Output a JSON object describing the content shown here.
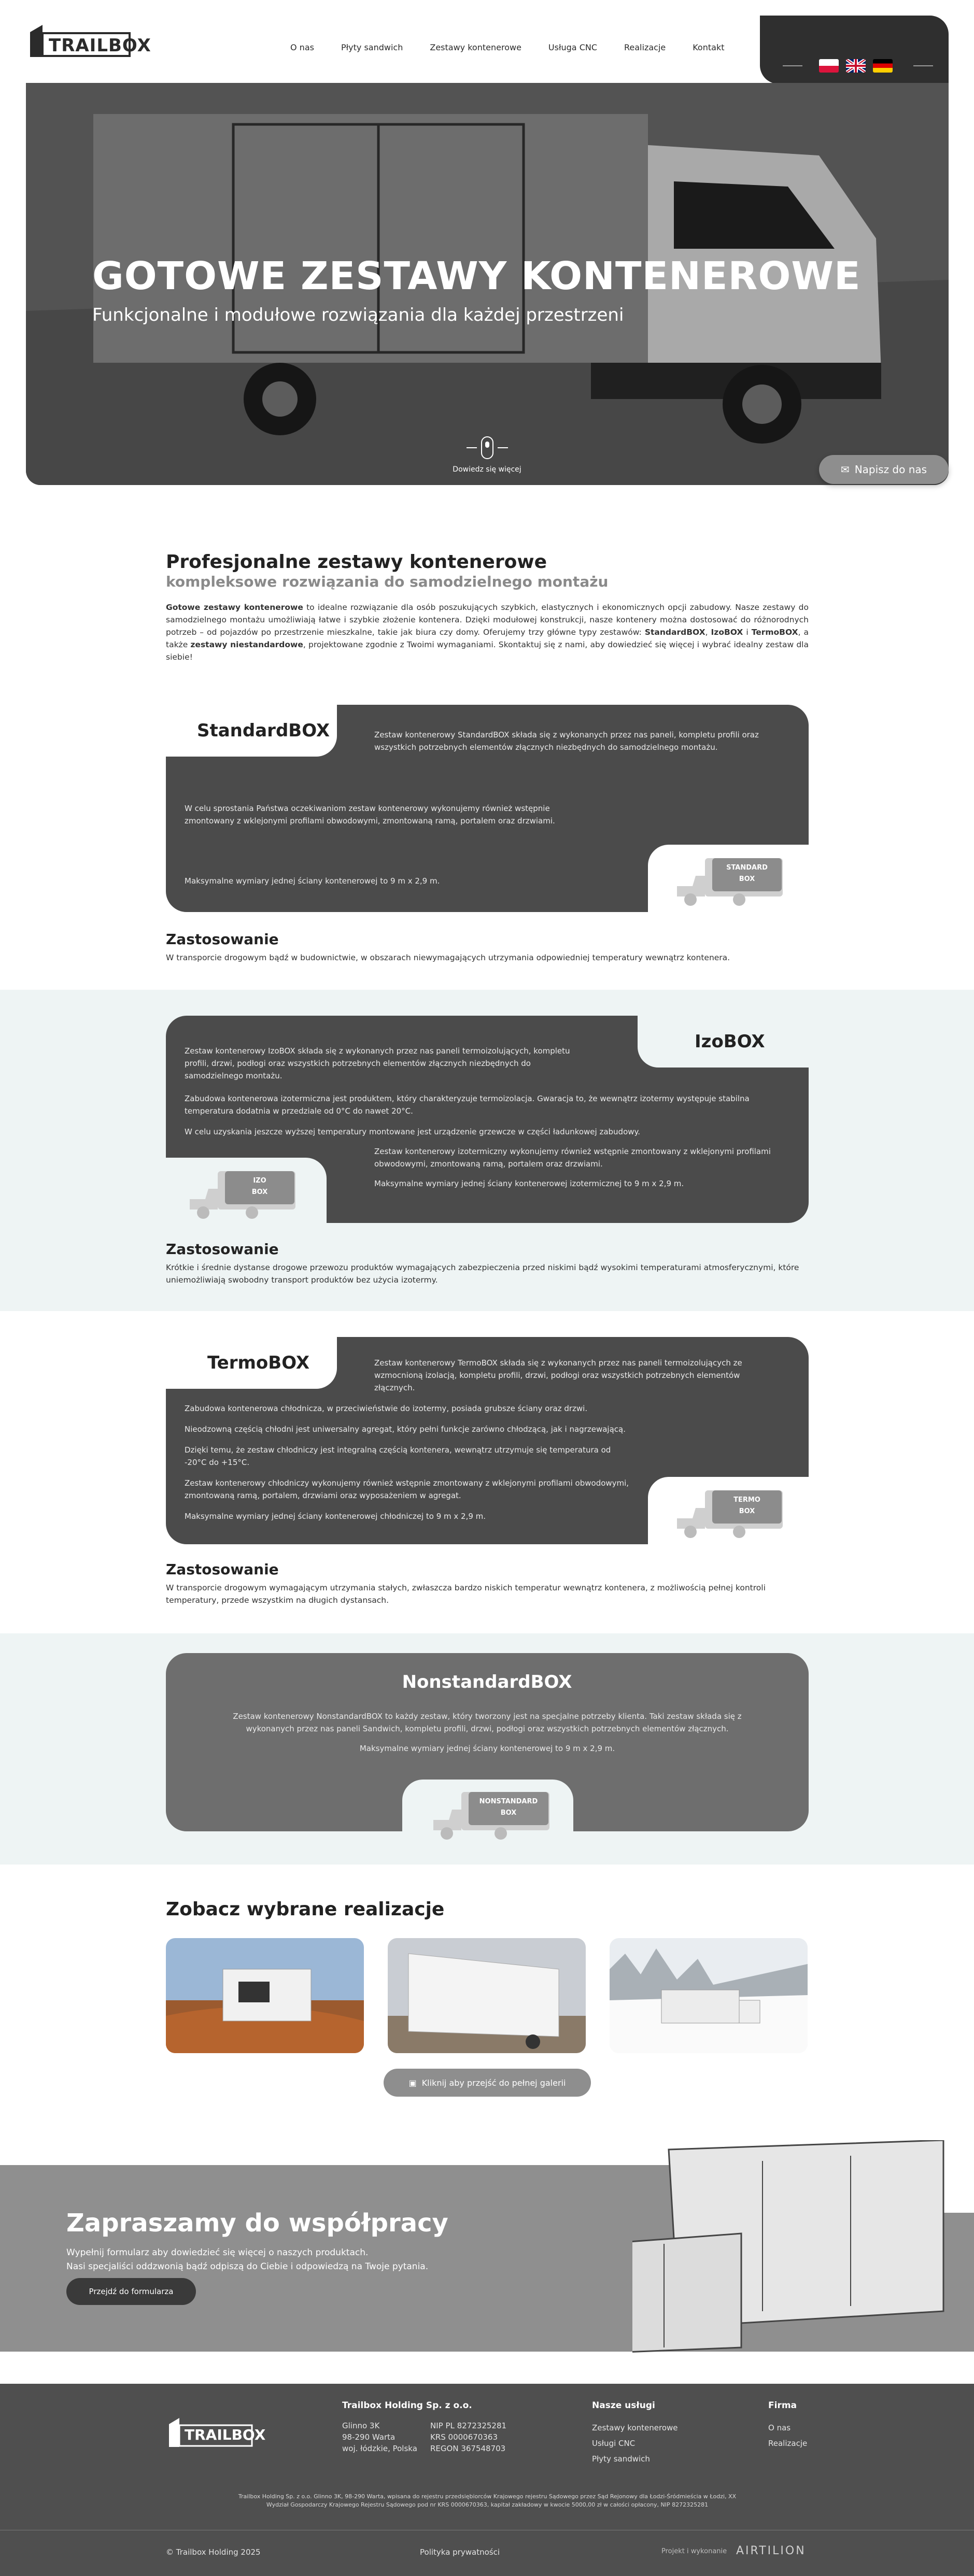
{
  "header": {
    "logo_text": "TRAILBOX",
    "nav": [
      "O nas",
      "Płyty sandwich",
      "Zestawy kontenerowe",
      "Usługa CNC",
      "Realizacje",
      "Kontakt"
    ]
  },
  "hero": {
    "title": "GOTOWE ZESTAWY KONTENEROWE",
    "subtitle": "Funkcjonalne i modułowe rozwiązania dla każdej przestrzeni",
    "scroll_label": "Dowiedz się więcej",
    "chat_button": "Napisz do nas"
  },
  "intro": {
    "title": "Profesjonalne zestawy kontenerowe",
    "subtitle": "kompleksowe rozwiązania do samodzielnego montażu",
    "p1_bold": "Gotowe zestawy kontenerowe",
    "p1_rest": " to idealne rozwiązanie dla osób poszukujących szybkich, elastycznych i ekonomicznych opcji zabudowy. Nasze zestawy do samodzielnego montażu umożliwiają łatwe i szybkie złożenie kontenera. Dzięki modułowej konstrukcji, nasze kontenery można dostosować do różnorodnych potrzeb – od pojazdów po przestrzenie mieszkalne, takie jak biura czy domy. Oferujemy trzy główne typy zestawów: ",
    "b1": "StandardBOX",
    "sep1": ", ",
    "b2": "IzoBOX",
    "sep2": " i ",
    "b3": "TermoBOX",
    "sep3": ", a także ",
    "b4": "zestawy niestandardowe",
    "p1_end": ", projektowane zgodnie z Twoimi wymaganiami. Skontaktuj się z nami, aby dowiedzieć się więcej i wybrać idealny zestaw dla siebie!"
  },
  "standard": {
    "title": "StandardBOX",
    "t1": "Zestaw kontenerowy StandardBOX składa się z wykonanych przez nas paneli, kompletu profili oraz wszystkich potrzebnych elementów złącznych niezbędnych do samodzielnego montażu.",
    "t2": "W celu sprostania Państwa oczekiwaniom zestaw kontenerowy wykonujemy również wstępnie zmontowany z wklejonymi profilami obwodowymi, zmontowaną ramą, portalem oraz drzwiami.",
    "t3": "Maksymalne wymiary jednej ściany kontenerowej to 9 m x 2,9 m.",
    "tag1": "STANDARD",
    "tag2": "BOX",
    "uses_title": "Zastosowanie",
    "uses": "W transporcie drogowym bądź w budownictwie, w obszarach niewymagających utrzymania odpowiedniej temperatury wewnątrz kontenera."
  },
  "izo": {
    "title": "IzoBOX",
    "t1": "Zestaw kontenerowy IzoBOX składa się z wykonanych przez nas paneli termoizolujących, kompletu profili, drzwi, podłogi oraz wszystkich potrzebnych elementów złącznych niezbędnych do samodzielnego montażu.",
    "t2": "Zabudowa kontenerowa izotermiczna jest produktem, który charakteryzuje termoizolacja. Gwaracja to, że wewnątrz izotermy występuje stabilna temperatura dodatnia w przedziale od 0°C do nawet 20°C.",
    "t3": "W celu uzyskania jeszcze wyższej temperatury montowane jest urządzenie grzewcze w części ładunkowej zabudowy.",
    "t4": "Zestaw kontenerowy izotermiczny wykonujemy również wstępnie zmontowany z wklejonymi profilami obwodowymi, zmontowaną ramą, portalem oraz drzwiami.",
    "t5": "Maksymalne wymiary jednej ściany kontenerowej izotermicznej to 9 m x 2,9 m.",
    "tag1": "IZO",
    "tag2": "BOX",
    "uses_title": "Zastosowanie",
    "uses": "Krótkie i średnie dystanse drogowe przewozu produktów wymagających zabezpieczenia przed niskimi bądź wysokimi temperaturami atmosferycznymi, które uniemożliwiają swobodny transport produktów bez użycia izotermy."
  },
  "termo": {
    "title": "TermoBOX",
    "t1": "Zestaw kontenerowy TermoBOX składa się z wykonanych przez nas paneli termoizolujących ze wzmocnioną izolacją, kompletu profili, drzwi, podłogi oraz wszystkich potrzebnych elementów złącznych.",
    "t2": "Zabudowa kontenerowa chłodnicza, w przeciwieństwie do izotermy, posiada grubsze ściany oraz drzwi.",
    "t3": "Nieodzowną częścią chłodni jest uniwersalny agregat, który pełni funkcje zarówno chłodzącą, jak i nagrzewającą.",
    "t4": "Dzięki temu, że zestaw chłodniczy jest integralną częścią kontenera, wewnątrz utrzymuje się temperatura od -20°C do +15°C.",
    "t5": "Zestaw kontenerowy chłodniczy wykonujemy również wstępnie zmontowany z wklejonymi profilami obwodowymi, zmontowaną ramą, portalem, drzwiami oraz wyposażeniem w agregat.",
    "t6": "Maksymalne wymiary jednej ściany kontenerowej chłodniczej to 9 m x 2,9 m.",
    "tag1": "TERMO",
    "tag2": "BOX",
    "uses_title": "Zastosowanie",
    "uses": "W transporcie drogowym wymagającym utrzymania stałych, zwłaszcza bardzo niskich temperatur wewnątrz kontenera, z możliwością pełnej kontroli temperatury, przede wszystkim na długich dystansach."
  },
  "nonstandard": {
    "title": "NonstandardBOX",
    "t1": "Zestaw kontenerowy NonstandardBOX to każdy zestaw, który tworzony jest na specjalne potrzeby klienta. Taki zestaw składa się z wykonanych przez nas paneli Sandwich, kompletu profili, drzwi, podłogi oraz wszystkich potrzebnych elementów złącznych.",
    "t2": "Maksymalne wymiary jednej ściany kontenerowej to 9 m x 2,9 m.",
    "tag1": "NONSTANDARD",
    "tag2": "BOX"
  },
  "gallery": {
    "title": "Zobacz wybrane realizacje",
    "button": "Kliknij aby przejść do pełnej galerii"
  },
  "coop": {
    "title": "Zapraszamy do współpracy",
    "p1": "Wypełnij formularz aby dowiedzieć się więcej o naszych produktach.",
    "p2": "Nasi specjaliści oddzwonią bądź odpiszą do Ciebie i odpowiedzą na Twoje pytania.",
    "button": "Przejdź do formularza"
  },
  "footer": {
    "company": "Trailbox Holding Sp. z o.o.",
    "addr1": "Glinno 3K",
    "addr2": "98-290 Warta",
    "addr3": "woj. łódzkie, Polska",
    "nip": "NIP PL 8272325281",
    "krs": "KRS 0000670363",
    "regon": "REGON 367548703",
    "services_h": "Nasze usługi",
    "services": [
      "Zestawy kontenerowe",
      "Usługi CNC",
      "Płyty sandwich"
    ],
    "firm_h": "Firma",
    "firm": [
      "O nas",
      "Realizacje"
    ],
    "legal": "Trailbox Holding Sp. z o.o. Glinno 3K, 98-290 Warta, wpisana do rejestru przedsiębiorców Krajowego rejestru Sądowego przez Sąd Rejonowy dla Łodzi-Śródmieścia w Łodzi, XX Wydział Gospodarczy Krajowego Rejestru Sądowego pod nr KRS 0000670363, kapitał zakładowy w kwocie 5000,00 zł w całości opłacony, NIP 8272325281",
    "copyright": "© Trailbox Holding 2025",
    "privacy": "Polityka prywatności",
    "credit": "Projekt i wykonanie",
    "credit_brand": "AIRTILION"
  },
  "colors": {
    "dark_box": "#4b4b4b",
    "band": "#eef4f4",
    "button_grey": "#8e8e8e"
  }
}
